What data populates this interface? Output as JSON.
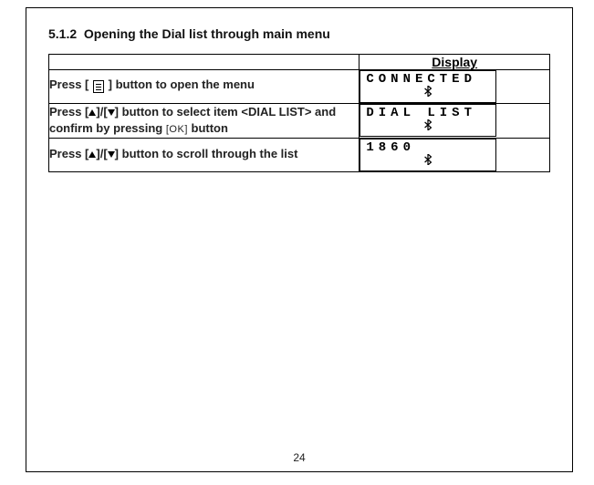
{
  "section": {
    "number": "5.1.2",
    "title": "Opening the Dial list through main menu"
  },
  "table": {
    "display_header": "Display",
    "rows": [
      {
        "step_pre": "Press ",
        "step_icon": "menu",
        "step_post": " button to open the menu",
        "lcd_text": "CONNECTED"
      },
      {
        "step_pre": "Press ",
        "step_btns": "updown",
        "step_mid": " button to select item <DIAL LIST> and confirm by pressing ",
        "step_ok": "[OK]",
        "step_post": " button",
        "lcd_text": "DIAL  LIST"
      },
      {
        "step_pre": "Press ",
        "step_btns": "updown",
        "step_post": " button to scroll through the list",
        "lcd_text": "1860"
      }
    ]
  },
  "page_number": "24"
}
